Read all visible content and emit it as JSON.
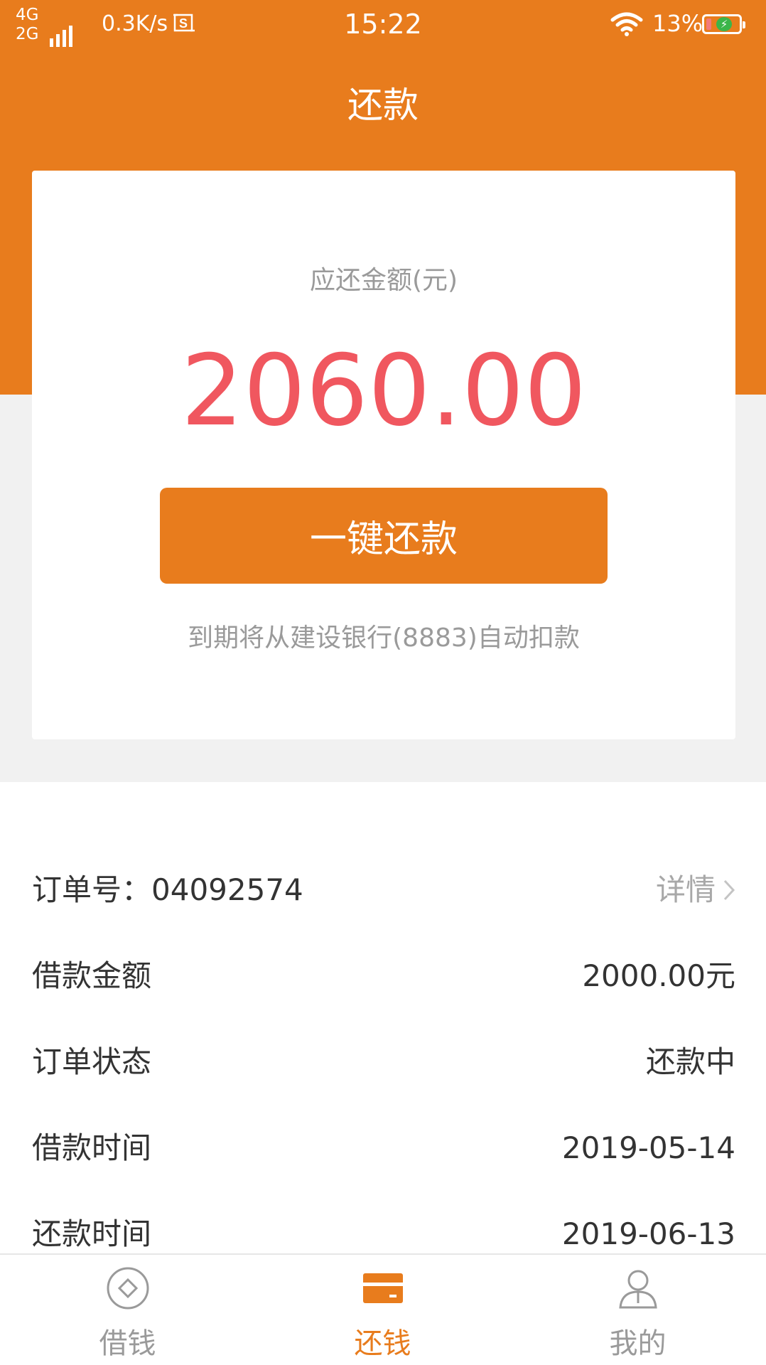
{
  "status_bar": {
    "network_top": "4G",
    "network_bottom": "2G",
    "speed": "0.3K/s",
    "time": "15:22",
    "battery": "13%"
  },
  "header": {
    "title": "还款"
  },
  "card": {
    "due_label": "应还金额(元)",
    "due_amount": "2060.00",
    "repay_button": "一键还款",
    "auto_debit_note": "到期将从建设银行(8883)自动扣款"
  },
  "details": {
    "order": {
      "label": "订单号：04092574",
      "link": "详情"
    },
    "rows": [
      {
        "label": "借款金额",
        "value": "2000.00元"
      },
      {
        "label": "订单状态",
        "value": "还款中"
      },
      {
        "label": "借款时间",
        "value": "2019-05-14"
      },
      {
        "label": "还款时间",
        "value": "2019-06-13"
      }
    ]
  },
  "tabs": [
    {
      "label": "借钱",
      "icon": "diamond-circle-icon",
      "active": false
    },
    {
      "label": "还钱",
      "icon": "card-icon",
      "active": true
    },
    {
      "label": "我的",
      "icon": "user-icon",
      "active": false
    }
  ],
  "colors": {
    "brand_orange": "#E87C1D",
    "amount_red": "#F0575F",
    "muted_gray": "#9A9A9A",
    "page_gray": "#F1F1F1"
  }
}
